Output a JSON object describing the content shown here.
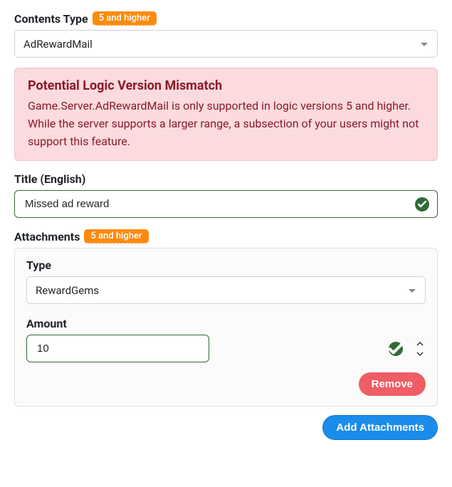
{
  "contents_type": {
    "label": "Contents Type",
    "badge": "5 and higher",
    "value": "AdRewardMail"
  },
  "alert": {
    "title": "Potential Logic Version Mismatch",
    "body": "Game.Server.AdRewardMail is only supported in logic versions 5 and higher. While the server supports a larger range, a subsection of your users might not support this feature."
  },
  "title_field": {
    "label": "Title (English)",
    "value": "Missed ad reward"
  },
  "attachments": {
    "label": "Attachments",
    "badge": "5 and higher",
    "items": [
      {
        "type_label": "Type",
        "type_value": "RewardGems",
        "amount_label": "Amount",
        "amount_value": "10",
        "remove_label": "Remove"
      }
    ],
    "add_label": "Add Attachments"
  }
}
